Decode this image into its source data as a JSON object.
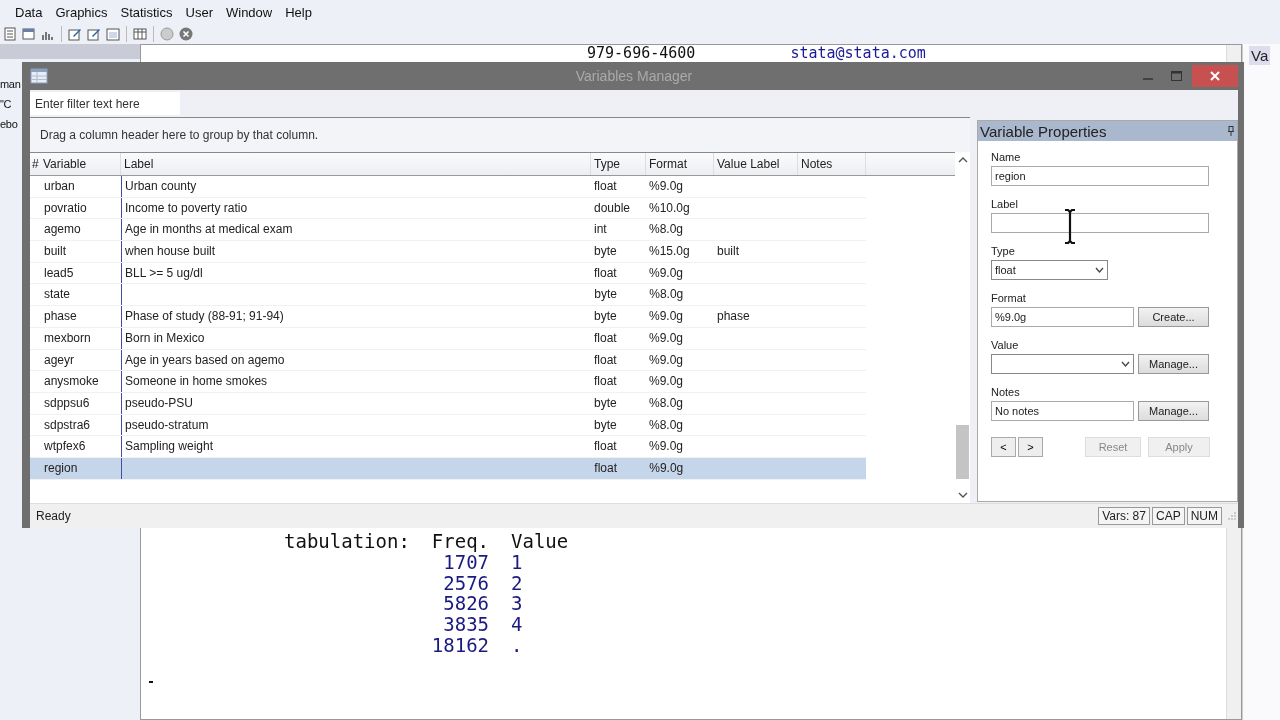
{
  "app": {
    "menu": [
      "Data",
      "Graphics",
      "Statistics",
      "User",
      "Window",
      "Help"
    ],
    "left_panel_fragments": [
      "man",
      "\"C",
      "ebo"
    ],
    "results_header": [
      "979-696-4600",
      "stata@stata.com"
    ],
    "output": {
      "label": "tabulation:",
      "freq_heading": "Freq.",
      "value_heading": "Value",
      "rows": [
        {
          "freq": "1707",
          "value": "1"
        },
        {
          "freq": "2576",
          "value": "2"
        },
        {
          "freq": "5826",
          "value": "3"
        },
        {
          "freq": "3835",
          "value": "4"
        },
        {
          "freq": "18162",
          "value": "."
        }
      ]
    },
    "side_panel_fragment": "Va"
  },
  "dialog": {
    "title": "Variables Manager",
    "filter": {
      "placeholder": "Enter filter text here"
    },
    "group_hint": "Drag a column header here to group by that column.",
    "columns": [
      "#",
      "Variable",
      "Label",
      "Type",
      "Format",
      "Value Label",
      "Notes"
    ],
    "rows": [
      {
        "variable": "urban",
        "label": "Urban county",
        "type": "float",
        "format": "%9.0g",
        "selected": false
      },
      {
        "variable": "povratio",
        "label": "Income to poverty ratio",
        "type": "double",
        "format": "%10.0g",
        "selected": false
      },
      {
        "variable": "agemo",
        "label": "Age in months at medical exam",
        "type": "int",
        "format": "%8.0g",
        "selected": false
      },
      {
        "variable": "built",
        "label": "when house built",
        "type": "byte",
        "format": "%15.0g",
        "value_label": "built",
        "selected": false
      },
      {
        "variable": "lead5",
        "label": "BLL >= 5 ug/dl",
        "type": "float",
        "format": "%9.0g",
        "selected": false
      },
      {
        "variable": "state",
        "type": "byte",
        "format": "%8.0g",
        "selected": false
      },
      {
        "variable": "phase",
        "label": "Phase of study (88-91; 91-94)",
        "type": "byte",
        "format": "%9.0g",
        "value_label": "phase",
        "selected": false
      },
      {
        "variable": "mexborn",
        "label": "Born in Mexico",
        "type": "float",
        "format": "%9.0g",
        "selected": false
      },
      {
        "variable": "ageyr",
        "label": "Age in years based on agemo",
        "type": "float",
        "format": "%9.0g",
        "selected": false
      },
      {
        "variable": "anysmoke",
        "label": "Someone in home smokes",
        "type": "float",
        "format": "%9.0g",
        "selected": false
      },
      {
        "variable": "sdppsu6",
        "label": "pseudo-PSU",
        "type": "byte",
        "format": "%8.0g",
        "selected": false
      },
      {
        "variable": "sdpstra6",
        "label": "pseudo-stratum",
        "type": "byte",
        "format": "%8.0g",
        "selected": false
      },
      {
        "variable": "wtpfex6",
        "label": "Sampling weight",
        "type": "float",
        "format": "%9.0g",
        "selected": false
      },
      {
        "variable": "region",
        "type": "float",
        "format": "%9.0g",
        "selected": true
      }
    ],
    "properties": {
      "title": "Variable Properties",
      "fields": [
        {
          "label": "Name",
          "kind": "text",
          "value": "region"
        },
        {
          "label": "Label",
          "kind": "text"
        },
        {
          "label": "Type",
          "kind": "select",
          "value": "float"
        },
        {
          "label": "Format",
          "kind": "text",
          "value": "%9.0g",
          "button": "Create..."
        },
        {
          "label": "Value",
          "kind": "select",
          "button": "Manage..."
        },
        {
          "label": "Notes",
          "kind": "text",
          "value": "No notes",
          "button": "Manage..."
        }
      ],
      "nav_buttons": [
        "<",
        ">"
      ],
      "actions": [
        {
          "label": "Reset",
          "disabled": true
        },
        {
          "label": "Apply",
          "disabled": true
        }
      ]
    },
    "status": "Ready",
    "indicators": [
      "Vars: 87",
      "CAP",
      "NUM"
    ]
  }
}
